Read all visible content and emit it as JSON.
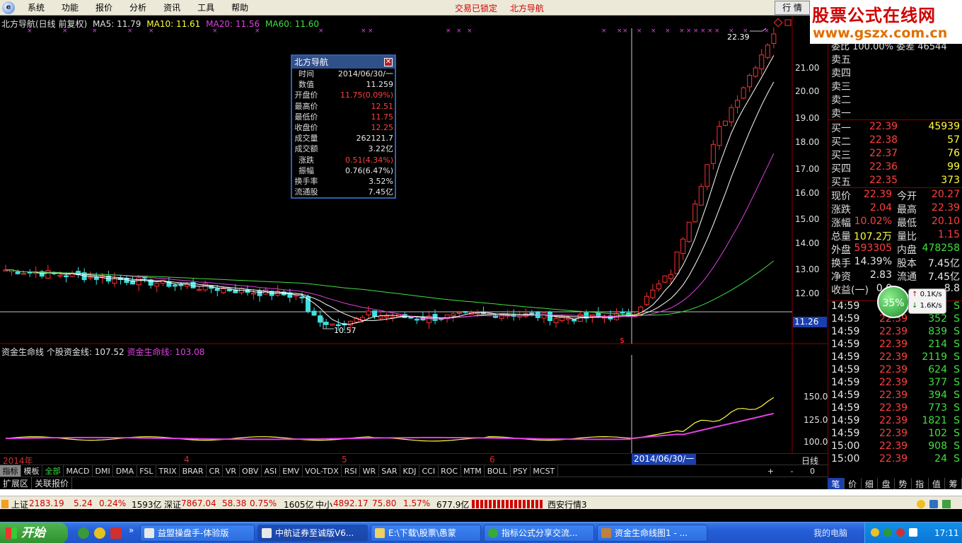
{
  "menu": [
    "系统",
    "功能",
    "报价",
    "分析",
    "资讯",
    "工具",
    "帮助"
  ],
  "menu_center": [
    "交易已锁定",
    "北方导航"
  ],
  "toolbar_right": "行 情",
  "brand": {
    "title": "股票公式在线网",
    "url": "www.gszx.com.cn"
  },
  "chart_header": {
    "name": "北方导航(日线 前复权)",
    "ma5": "MA5: 11.79",
    "ma10": "MA10: 11.61",
    "ma20": "MA20: 11.56",
    "ma60": "MA60: 11.60"
  },
  "indicator_header": {
    "name": "资金生命线",
    "line1": "个股资金线: 107.52",
    "line2": "资金生命线: 103.08"
  },
  "popup": {
    "title": "北方导航",
    "rows": [
      {
        "k": "时间",
        "v": "2014/06/30/一",
        "c": "white"
      },
      {
        "k": "数值",
        "v": "11.259",
        "c": "white"
      },
      {
        "k": "开盘价",
        "v": "11.75(0.09%)",
        "c": "red"
      },
      {
        "k": "最高价",
        "v": "12.51",
        "c": "red"
      },
      {
        "k": "最低价",
        "v": "11.75",
        "c": "red"
      },
      {
        "k": "收盘价",
        "v": "12.25",
        "c": "red"
      },
      {
        "k": "成交量",
        "v": "262121.7",
        "c": "white"
      },
      {
        "k": "成交额",
        "v": "3.22亿",
        "c": "white"
      },
      {
        "k": "涨跌",
        "v": "0.51(4.34%)",
        "c": "red"
      },
      {
        "k": "振幅",
        "v": "0.76(6.47%)",
        "c": "white"
      },
      {
        "k": "换手率",
        "v": "3.52%",
        "c": "white"
      },
      {
        "k": "流通股",
        "v": "7.45亿",
        "c": "white"
      }
    ]
  },
  "price_axis": [
    "21.00",
    "20.00",
    "19.00",
    "18.00",
    "17.00",
    "16.00",
    "15.00",
    "14.00",
    "13.00",
    "12.00"
  ],
  "indicator_axis": [
    "150.0",
    "125.0",
    "100.0"
  ],
  "current_price_tag": "11.26",
  "annotations": {
    "high": "22.39",
    "low": "10.57",
    "marker": "$"
  },
  "date_bar": {
    "year": "2014年",
    "m4": "4",
    "m5": "5",
    "m6": "6",
    "selected": "2014/06/30/一",
    "period": "日线"
  },
  "indicator_tabs": [
    "指标",
    "模板",
    "全部",
    "MACD",
    "DMI",
    "DMA",
    "FSL",
    "TRIX",
    "BRAR",
    "CR",
    "VR",
    "OBV",
    "ASI",
    "EMV",
    "VOL-TDX",
    "RSI",
    "WR",
    "SAR",
    "KDJ",
    "CCI",
    "ROC",
    "MTM",
    "BOLL",
    "PSY",
    "MCST"
  ],
  "indicator_ctrl": "+ - 0",
  "ext_tabs": [
    "扩展区",
    "关联报价"
  ],
  "order_book": {
    "webi": "委比 100.00% 委差 46544",
    "sell": [
      "卖五",
      "卖四",
      "卖三",
      "卖二",
      "卖一"
    ],
    "buy": [
      {
        "label": "买一",
        "price": "22.39",
        "vol": "45939"
      },
      {
        "label": "买二",
        "price": "22.38",
        "vol": "57"
      },
      {
        "label": "买三",
        "price": "22.37",
        "vol": "76"
      },
      {
        "label": "买四",
        "price": "22.36",
        "vol": "99"
      },
      {
        "label": "买五",
        "price": "22.35",
        "vol": "373"
      }
    ]
  },
  "quote": [
    {
      "l1": "现价",
      "v1": "22.39",
      "c1": "red",
      "l2": "今开",
      "v2": "20.27",
      "c2": "red"
    },
    {
      "l1": "涨跌",
      "v1": "2.04",
      "c1": "red",
      "l2": "最高",
      "v2": "22.39",
      "c2": "red"
    },
    {
      "l1": "涨幅",
      "v1": "10.02%",
      "c1": "red",
      "l2": "最低",
      "v2": "20.10",
      "c2": "red"
    },
    {
      "l1": "总量",
      "v1": "107.2万",
      "c1": "yellow",
      "l2": "量比",
      "v2": "1.15",
      "c2": "red"
    },
    {
      "l1": "外盘",
      "v1": "593305",
      "c1": "red",
      "l2": "内盘",
      "v2": "478258",
      "c2": "green"
    },
    {
      "l1": "换手",
      "v1": "14.39%",
      "c1": "white",
      "l2": "股本",
      "v2": "7.45亿",
      "c2": "white"
    },
    {
      "l1": "净资",
      "v1": "2.83",
      "c1": "white",
      "l2": "流通",
      "v2": "7.45亿",
      "c2": "white"
    },
    {
      "l1": "收益(一)",
      "v1": "0.0",
      "c1": "white",
      "l2": "",
      "v2": "8.8",
      "c2": "white"
    }
  ],
  "speed_ball": "35%",
  "net_speed": {
    "up": "0.1K/s",
    "down": "1.6K/s"
  },
  "trades": [
    {
      "t": "14:59",
      "p": "22.39",
      "v": "",
      "s": "S"
    },
    {
      "t": "14:59",
      "p": "22.39",
      "v": "352",
      "s": "S"
    },
    {
      "t": "14:59",
      "p": "22.39",
      "v": "839",
      "s": "S"
    },
    {
      "t": "14:59",
      "p": "22.39",
      "v": "214",
      "s": "S"
    },
    {
      "t": "14:59",
      "p": "22.39",
      "v": "2119",
      "s": "S"
    },
    {
      "t": "14:59",
      "p": "22.39",
      "v": "624",
      "s": "S"
    },
    {
      "t": "14:59",
      "p": "22.39",
      "v": "377",
      "s": "S"
    },
    {
      "t": "14:59",
      "p": "22.39",
      "v": "394",
      "s": "S"
    },
    {
      "t": "14:59",
      "p": "22.39",
      "v": "773",
      "s": "S"
    },
    {
      "t": "14:59",
      "p": "22.39",
      "v": "1821",
      "s": "S"
    },
    {
      "t": "14:59",
      "p": "22.39",
      "v": "102",
      "s": "S"
    },
    {
      "t": "15:00",
      "p": "22.39",
      "v": "908",
      "s": "S"
    },
    {
      "t": "15:00",
      "p": "22.39",
      "v": "24",
      "s": "S"
    }
  ],
  "right_tabs": [
    "笔",
    "价",
    "细",
    "盘",
    "势",
    "指",
    "值",
    "筹"
  ],
  "index_bar": {
    "sh_name": "上证",
    "sh_val": "2183.19",
    "sh_chg": "5.24",
    "sh_pct": "0.24%",
    "sh_amt": "1593亿",
    "sz_name": "深证",
    "sz_val": "7867.04",
    "sz_chg": "58.38",
    "sz_pct": "0.75%",
    "sz_amt": "1605亿",
    "zx_name": "中小",
    "zx_val": "4892.17",
    "zx_chg": "75.80",
    "zx_pct": "1.57%",
    "zx_amt": "677.9亿",
    "server": "西安行情3"
  },
  "taskbar": {
    "start": "开始",
    "tasks": [
      "益盟操盘手-体验版",
      "中航证券至诚版V6...",
      "E:\\下载\\股票\\愚蒙",
      "指标公式分享交流...",
      "资金生命线图1 - ..."
    ],
    "mypc": "我的电脑",
    "clock": "17:11"
  }
}
